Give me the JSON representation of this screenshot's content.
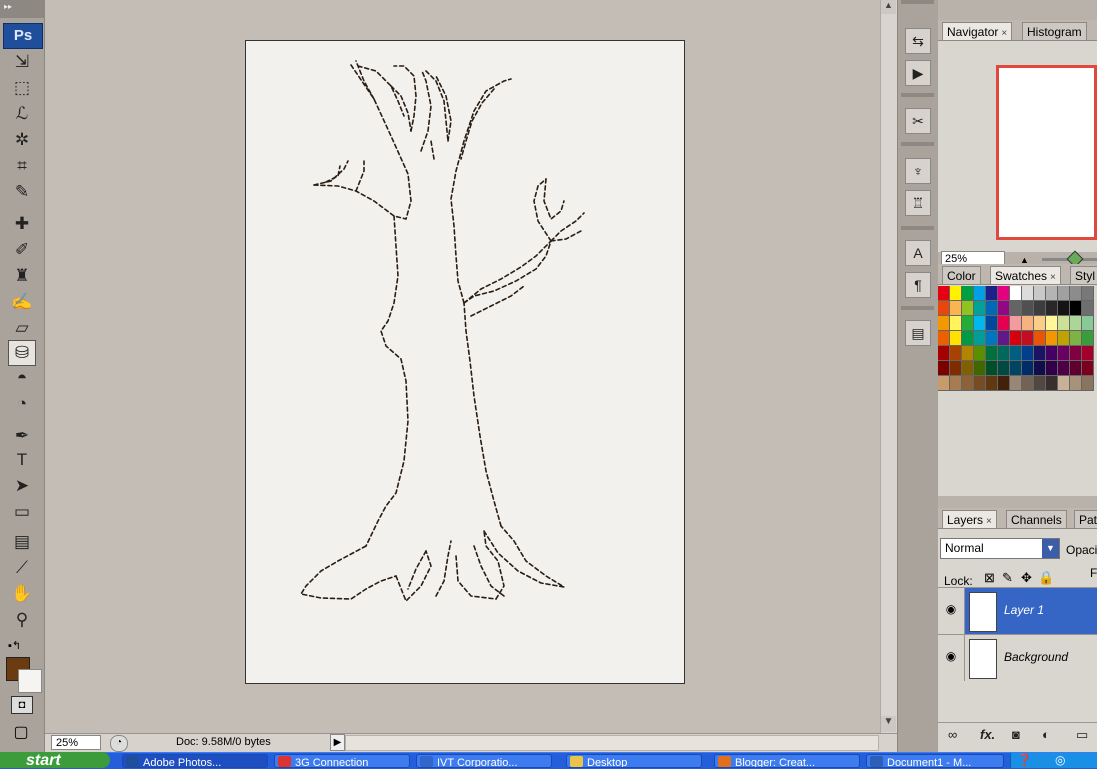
{
  "app": {
    "logo": "Ps"
  },
  "toolbox": {
    "tools": [
      {
        "name": "move-tool",
        "glyph": "⇲"
      },
      {
        "name": "marquee-tool",
        "glyph": "⬚"
      },
      {
        "name": "lasso-tool",
        "glyph": "ℒ"
      },
      {
        "name": "magic-wand-tool",
        "glyph": "✲"
      },
      {
        "name": "crop-tool",
        "glyph": "⌗"
      },
      {
        "name": "eyedropper-slice-tool",
        "glyph": "✎"
      },
      {
        "name": "healing-brush-tool",
        "glyph": "✚"
      },
      {
        "name": "brush-tool",
        "glyph": "✐"
      },
      {
        "name": "clone-stamp-tool",
        "glyph": "♜"
      },
      {
        "name": "history-brush-tool",
        "glyph": "✍"
      },
      {
        "name": "eraser-tool",
        "glyph": "▱"
      },
      {
        "name": "paint-bucket-tool",
        "glyph": "⛁"
      },
      {
        "name": "blur-tool",
        "glyph": "◓"
      },
      {
        "name": "dodge-tool",
        "glyph": "◔"
      },
      {
        "name": "pen-tool",
        "glyph": "✒"
      },
      {
        "name": "type-tool",
        "glyph": "T"
      },
      {
        "name": "path-selection-tool",
        "glyph": "➤"
      },
      {
        "name": "shape-tool",
        "glyph": "▭"
      },
      {
        "name": "notes-tool",
        "glyph": "▤"
      },
      {
        "name": "eyedropper-tool",
        "glyph": "⟋"
      },
      {
        "name": "hand-tool",
        "glyph": "✋"
      },
      {
        "name": "zoom-tool",
        "glyph": "⚲"
      }
    ],
    "quick_mask_glyph": "◘",
    "screen_mode_glyph": "▢",
    "foreground_color": "#6b3c10",
    "background_color": "#f6f4f0"
  },
  "status": {
    "zoom": "25%",
    "doc_info": "Doc: 9.58M/0 bytes"
  },
  "panels": {
    "navigator": {
      "tabs": [
        {
          "label": "Navigator",
          "close": "×"
        },
        {
          "label": "Histogram"
        }
      ],
      "zoom": "25%"
    },
    "color": {
      "tabs": [
        {
          "label": "Color"
        },
        {
          "label": "Swatches",
          "close": "×"
        },
        {
          "label": "Styl"
        }
      ]
    },
    "layers": {
      "tabs": [
        {
          "label": "Layers",
          "close": "×"
        },
        {
          "label": "Channels"
        },
        {
          "label": "Pat"
        }
      ],
      "blend_mode": "Normal",
      "opacity_label": "Opaci",
      "lock_label": "Lock:",
      "fill_label": "F",
      "layers": [
        {
          "name": "Layer 1",
          "selected": true
        },
        {
          "name": "Background",
          "selected": false
        }
      ]
    }
  },
  "taskbar": {
    "start_label": "start",
    "tasks": [
      {
        "label": "Adobe Photos..."
      },
      {
        "label": "3G Connection"
      },
      {
        "label": "IVT Corporatio..."
      },
      {
        "label": "Desktop"
      },
      {
        "label": "Blogger: Creat..."
      },
      {
        "label": "Document1 - M..."
      }
    ]
  }
}
